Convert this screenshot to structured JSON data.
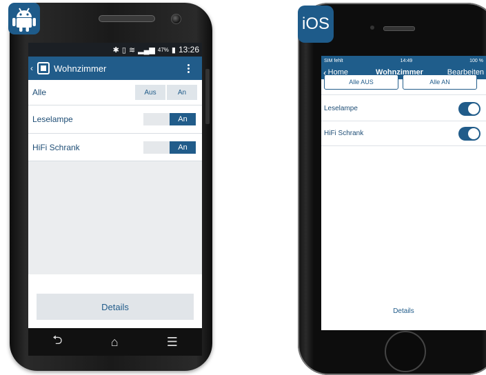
{
  "android": {
    "status_time": "13:26",
    "battery": "47%",
    "title": "Wohnzimmer",
    "all_label": "Alle",
    "all_off": "Aus",
    "all_on": "An",
    "devices": [
      {
        "label": "Leselampe",
        "state": "An"
      },
      {
        "label": "HiFi Schrank",
        "state": "An"
      }
    ],
    "details": "Details"
  },
  "ios": {
    "badge": "iOS",
    "carrier": "SIM fehlt",
    "time": "14:49",
    "battery": "100 %",
    "back_label": "Home",
    "title": "Wohnzimmer",
    "edit_label": "Bearbeiten",
    "all_off": "Alle AUS",
    "all_on": "Alle AN",
    "devices": [
      {
        "label": "Leselampe",
        "on": true
      },
      {
        "label": "HiFi Schrank",
        "on": true
      }
    ],
    "details": "Details"
  }
}
